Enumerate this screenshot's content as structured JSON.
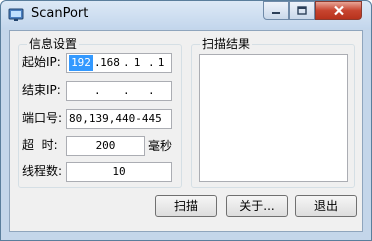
{
  "window": {
    "title": "ScanPort",
    "icon": "network-scan-icon"
  },
  "title_controls": {
    "minimize": "minimize-icon",
    "maximize": "maximize-icon",
    "close": "close-icon"
  },
  "settings": {
    "group_title": "信息设置",
    "start_ip_label": "起始IP:",
    "start_ip": [
      "192",
      "168",
      "1",
      "1"
    ],
    "end_ip_label": "结束IP:",
    "end_ip": [
      "",
      "",
      "",
      ""
    ],
    "ports_label": "端口号:",
    "ports_value": "80,139,440-445",
    "timeout_label": "超  时:",
    "timeout_value": "200",
    "timeout_unit": "毫秒",
    "threads_label": "线程数:",
    "threads_value": "10"
  },
  "results": {
    "group_title": "扫描结果",
    "items": []
  },
  "buttons": {
    "scan": "扫描",
    "about": "关于...",
    "exit": "退出"
  },
  "colors": {
    "selection": "#3399ff",
    "close_button": "#c7442f",
    "frame": "#c4d6ea"
  }
}
